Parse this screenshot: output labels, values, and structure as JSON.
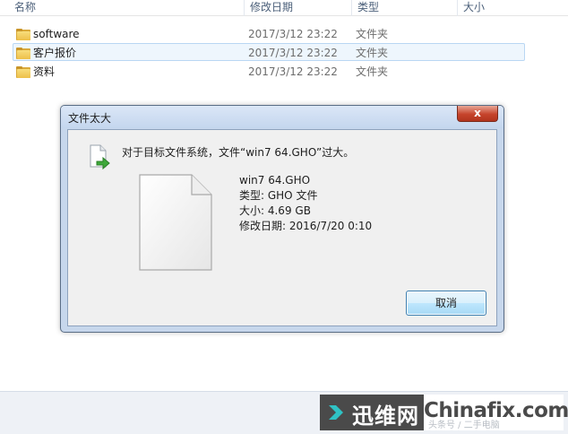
{
  "explorer": {
    "columns": {
      "name": "名称",
      "date": "修改日期",
      "type": "类型",
      "size": "大小"
    },
    "rows": [
      {
        "name": "software",
        "date": "2017/3/12 23:22",
        "type": "文件夹"
      },
      {
        "name": "客户报价",
        "date": "2017/3/12 23:22",
        "type": "文件夹"
      },
      {
        "name": "资料",
        "date": "2017/3/12 23:22",
        "type": "文件夹"
      }
    ]
  },
  "dialog": {
    "title": "文件太大",
    "close_label": "x",
    "message": "对于目标文件系统，文件“win7 64.GHO”过大。",
    "file": {
      "name": "win7 64.GHO",
      "type": "类型: GHO 文件",
      "size": "大小: 4.69 GB",
      "modified": "修改日期: 2016/7/20 0:10"
    },
    "cancel_label": "取消"
  },
  "watermark": {
    "logo": "迅维网",
    "site": "Chinafix.com",
    "text": "头条号 / 二手电脑"
  },
  "colors": {
    "titlebar": "#c4d6ee",
    "close_button": "#c6442c",
    "folder": "#eec04a",
    "watermark_dark": "#4a4a4a",
    "watermark_accent": "#2fc2c4"
  }
}
